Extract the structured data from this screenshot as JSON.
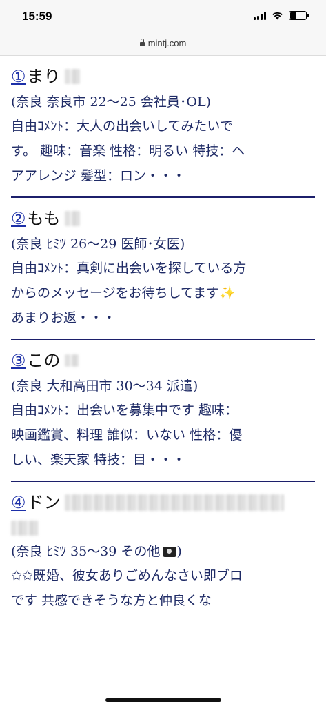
{
  "status": {
    "time": "15:59"
  },
  "browser": {
    "url": "mintj.com"
  },
  "entries": [
    {
      "num": "①",
      "name": "まり",
      "meta": "(奈良 奈良市 22〜25 会社員･OL)",
      "lines": [
        "自由ｺﾒﾝﾄ：大人の出会いしてみたいで",
        "す。 趣味：音楽 性格：明るい 特技：ヘ",
        "アアレンジ 髪型：ロン・・・"
      ]
    },
    {
      "num": "②",
      "name": "もも",
      "meta": "(奈良 ﾋﾐﾂ 26〜29 医師･女医)",
      "lines": [
        "自由ｺﾒﾝﾄ：真剣に出会いを探している方",
        "からのメッセージをお待ちしてます",
        "あまりお返・・・"
      ],
      "sparkle": "✨"
    },
    {
      "num": "③",
      "name": "この",
      "meta": "(奈良 大和高田市 30〜34 派遣)",
      "lines": [
        "自由ｺﾒﾝﾄ：出会いを募集中です 趣味：",
        "映画鑑賞、料理 誰似：いない 性格：優",
        "しい、楽天家 特技：目・・・"
      ]
    },
    {
      "num": "④",
      "name": "ドン",
      "meta": "(奈良 ﾋﾐﾂ 35〜39 その他",
      "lines": [
        "✩✩既婚、彼女ありごめんなさい即ブロ",
        "です 共感できそうな方と仲良くな"
      ]
    }
  ]
}
